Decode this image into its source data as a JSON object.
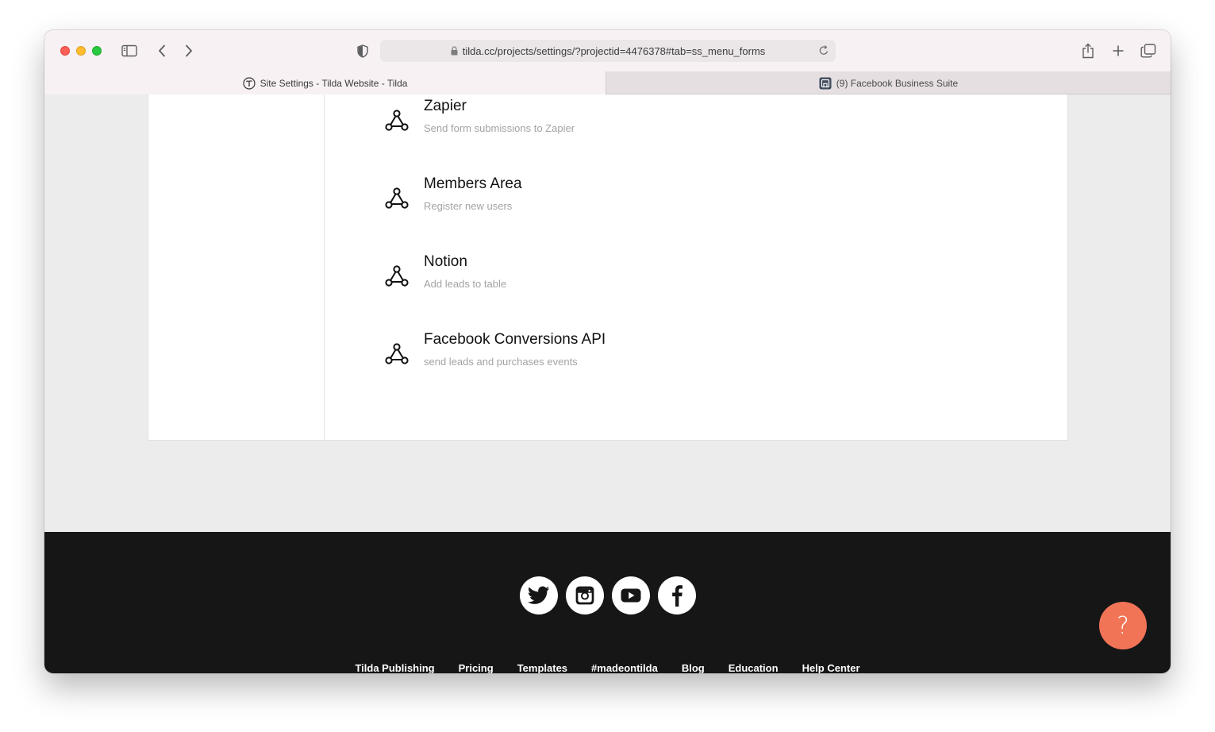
{
  "browser": {
    "url": "tilda.cc/projects/settings/?projectid=4476378#tab=ss_menu_forms",
    "tabs": [
      {
        "label": "Site Settings - Tilda Website - Tilda",
        "active": true,
        "icon": "tilda-logo-icon"
      },
      {
        "label": "(9) Facebook Business Suite",
        "active": false,
        "icon": "facebook-business-suite-icon"
      }
    ]
  },
  "integrations": [
    {
      "title": "Zapier",
      "description": "Send form submissions to Zapier",
      "icon": "integration-network-icon"
    },
    {
      "title": "Members Area",
      "description": "Register new users",
      "icon": "integration-network-icon"
    },
    {
      "title": "Notion",
      "description": "Add leads to table",
      "icon": "integration-network-icon"
    },
    {
      "title": "Facebook Conversions API",
      "description": "send leads and purchases events",
      "icon": "integration-network-icon"
    }
  ],
  "footer": {
    "socials": [
      "twitter-icon",
      "instagram-icon",
      "youtube-icon",
      "facebook-icon"
    ],
    "links": [
      "Tilda Publishing",
      "Pricing",
      "Templates",
      "#madeontilda",
      "Blog",
      "Education",
      "Help Center"
    ]
  },
  "help_button": {
    "label": "?"
  },
  "colors": {
    "help_button": "#f27457",
    "footer_bg": "#161616",
    "page_bg": "#ececec"
  }
}
